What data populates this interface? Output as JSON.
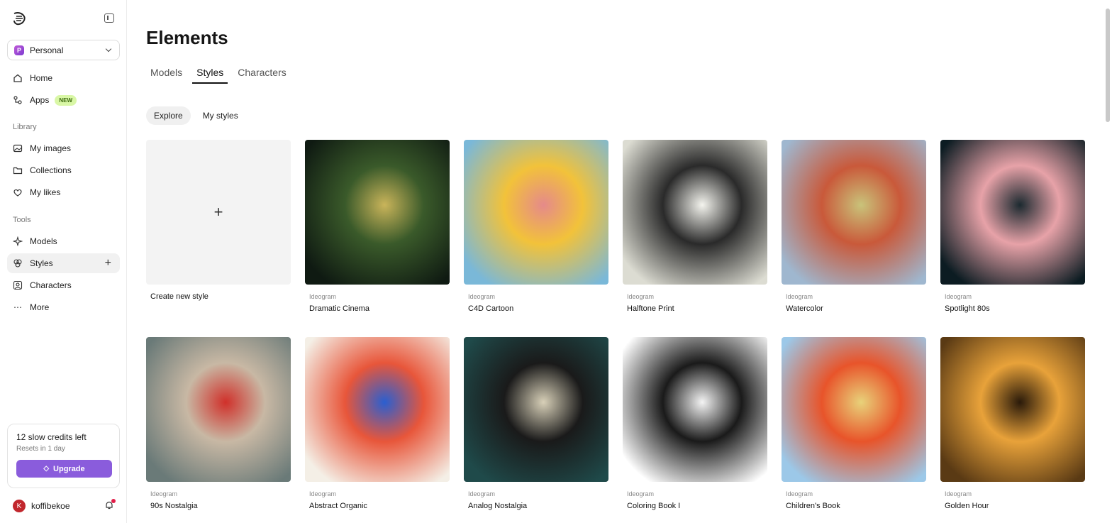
{
  "sidebar": {
    "workspace": {
      "badge": "P",
      "name": "Personal"
    },
    "nav": {
      "home": "Home",
      "apps": "Apps",
      "apps_badge": "NEW"
    },
    "library_label": "Library",
    "library": {
      "my_images": "My images",
      "collections": "Collections",
      "my_likes": "My likes"
    },
    "tools_label": "Tools",
    "tools": {
      "models": "Models",
      "styles": "Styles",
      "characters": "Characters",
      "more": "More"
    },
    "credits": {
      "title": "12 slow credits left",
      "sub": "Resets in 1 day",
      "upgrade": "Upgrade"
    },
    "user": {
      "initial": "K",
      "name": "koffibekoe"
    }
  },
  "main": {
    "title": "Elements",
    "tabs": [
      "Models",
      "Styles",
      "Characters"
    ],
    "subtabs": [
      "Explore",
      "My styles"
    ],
    "create_label": "Create new style",
    "create_plus": "+",
    "cards": [
      {
        "vendor": "Ideogram",
        "name": "Dramatic Cinema",
        "palette": [
          "#0f1a12",
          "#3a5a2a",
          "#c9b45a"
        ]
      },
      {
        "vendor": "Ideogram",
        "name": "C4D Cartoon",
        "palette": [
          "#7ab8d8",
          "#f2c23a",
          "#e58a8a"
        ]
      },
      {
        "vendor": "Ideogram",
        "name": "Halftone Print",
        "palette": [
          "#dcdcd2",
          "#2a2a2a",
          "#f4f4ee"
        ]
      },
      {
        "vendor": "Ideogram",
        "name": "Watercolor",
        "palette": [
          "#9fb7cf",
          "#c9593a",
          "#c9c37a"
        ]
      },
      {
        "vendor": "Ideogram",
        "name": "Spotlight 80s",
        "palette": [
          "#0c1c22",
          "#e7a2a8",
          "#1c2a30"
        ]
      },
      {
        "vendor": "Ideogram",
        "name": "90s Nostalgia",
        "palette": [
          "#6a7a78",
          "#c8b8a4",
          "#d0302a"
        ]
      },
      {
        "vendor": "Ideogram",
        "name": "Abstract Organic",
        "palette": [
          "#f4efe6",
          "#e8563a",
          "#2a5fd0"
        ]
      },
      {
        "vendor": "Ideogram",
        "name": "Analog Nostalgia",
        "palette": [
          "#1f4a4a",
          "#1a1a1a",
          "#d8d0b8"
        ]
      },
      {
        "vendor": "Ideogram",
        "name": "Coloring Book I",
        "palette": [
          "#ffffff",
          "#1a1a1a",
          "#f4f4f4"
        ]
      },
      {
        "vendor": "Ideogram",
        "name": "Children's Book",
        "palette": [
          "#9cc8e8",
          "#e8542a",
          "#e8d27a"
        ]
      },
      {
        "vendor": "Ideogram",
        "name": "Golden Hour",
        "palette": [
          "#5a3a14",
          "#e8a23a",
          "#2a1a0a"
        ]
      }
    ]
  }
}
